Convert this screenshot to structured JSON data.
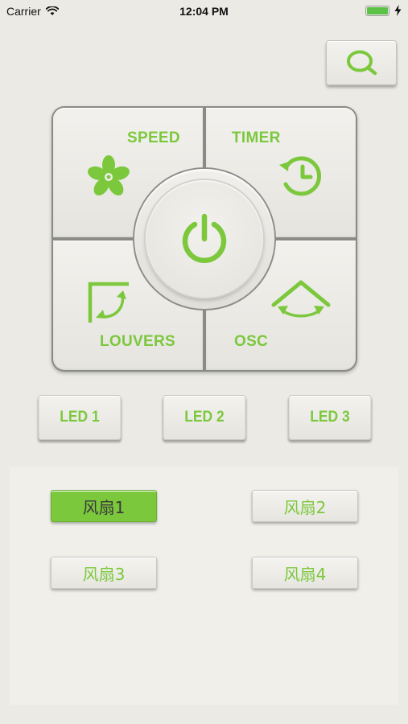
{
  "status_bar": {
    "carrier": "Carrier",
    "time": "12:04 PM"
  },
  "pad": {
    "speed_label": "SPEED",
    "timer_label": "TIMER",
    "louvers_label": "LOUVERS",
    "osc_label": "OSC"
  },
  "led_buttons": [
    "LED 1",
    "LED 2",
    "LED 3"
  ],
  "fans": [
    {
      "label": "风扇1",
      "selected": true
    },
    {
      "label": "风扇2",
      "selected": false
    },
    {
      "label": "风扇3",
      "selected": false
    },
    {
      "label": "风扇4",
      "selected": false
    }
  ],
  "colors": {
    "accent": "#7cc83c",
    "background": "#ebeae5",
    "panel": "#f0efea",
    "battery": "#5cc247"
  },
  "icons": {
    "search": "search-icon",
    "speed": "fan-icon",
    "timer": "timer-icon",
    "power": "power-icon",
    "louvers": "louvers-icon",
    "osc": "oscillate-icon"
  }
}
